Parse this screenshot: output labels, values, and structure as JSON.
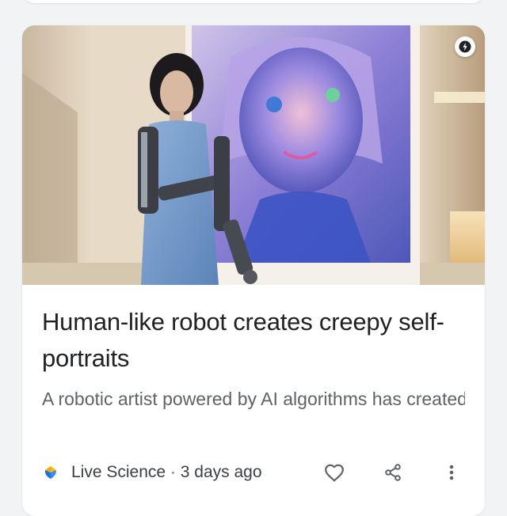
{
  "article": {
    "title": "Human-like robot creates creepy self-portraits",
    "snippet": "A robotic artist powered by AI algorithms has created realistic self-portraits that question t...",
    "source": "Live Science",
    "separator": "·",
    "time": "3 days ago",
    "image_alt": "Humanoid robot in blue dress standing in front of a colorful painted self-portrait"
  },
  "icons": {
    "amp": "lightning-bolt-icon",
    "source_logo": "live-science-logo-icon",
    "like": "heart-outline-icon",
    "share": "share-icon",
    "more": "more-vert-icon"
  },
  "colors": {
    "page_bg": "#f1f3f4",
    "card_bg": "#ffffff",
    "title": "#202124",
    "snippet": "#5f6368",
    "icon": "#5f6368",
    "logo_blue": "#1a73e8",
    "logo_yellow": "#fbbc04"
  }
}
